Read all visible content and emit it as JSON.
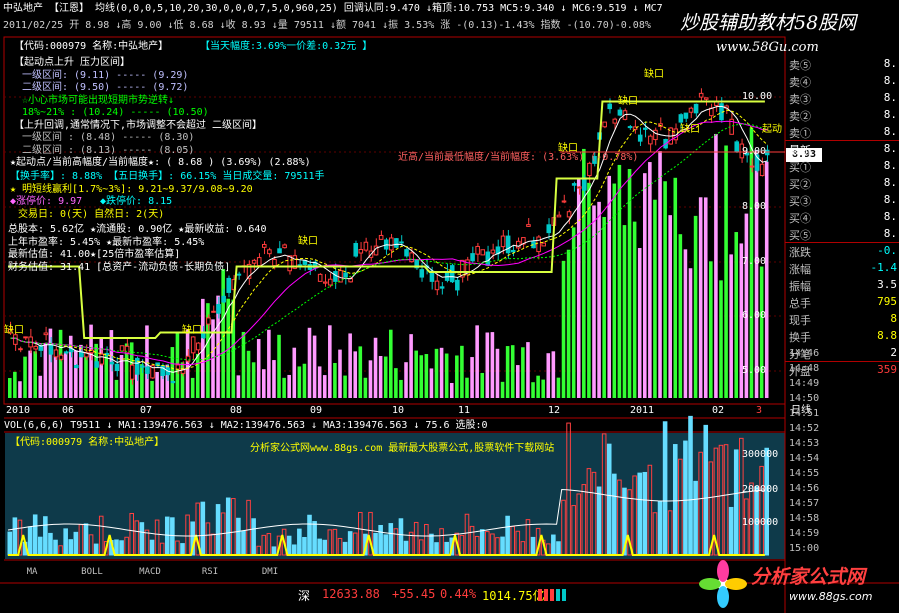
{
  "header": {
    "line1": "中弘地产  【江恩】 均线(0,0,0,5,10,20,30,0,0,0,7,5,0,960,25)  回调认同:9.470 ↓箱顶:10.753  MC5:9.340 ↓ MC6:9.519 ↓ MC7",
    "line2": "2011/02/25  开 8.98 ↓高 9.00 ↓低 8.68 ↓收 8.93 ↓量 79511 ↓额 7041 ↓振 3.53% 涨 -(0.13)-1.43% 指数 -(10.70)-0.08%",
    "watermark": "炒股辅助教材58股网",
    "watermark_url": "www.58Gu.com"
  },
  "info": {
    "code_name": "【代码:000979 名称:中弘地产】",
    "today_range": "【当天幅度:3.69%一价差:0.32元 】",
    "start_up": "【起动点上升  压力区间】",
    "zone1": "一级区间: (9.11) ----- (9.29)",
    "zone2": "二级区间: (9.50) ----- (9.72)",
    "warn": "☆小心市场可能出现短期市势逆转↓",
    "range_pct": "18%~21%  : (10.24) ----- (10.50)",
    "pullback": "【上升回调,通常情况下,市场调整不会超过 二级区间】",
    "pb_zone1": "一级区间  : (8.48) ----- (8.30)",
    "pb_zone2": "二级区间  : (8.13) ----- (8.05)",
    "start_line": "★起动点/当前高幅度/当前幅度★: ( 8.68  )  (3.69%)  (2.88%)",
    "turnover": "【换手率】: 8.88%  【五日换手】: 66.15% 当日成交量: 79511手",
    "profit": "明短线赢利[1.7%~3%]: 9.21~9.37/9.08~9.20",
    "limit_up": "涨停价: 9.97",
    "limit_down": "跌停价: 8.15",
    "trade_days": "交易日: 0(天)  自然日: 2(天)",
    "capital": "总股本: 5.62亿  ★流通股: 0.90亿  ★最新收益: 0.640",
    "pe1": "上年市盈率: 5.45%  ★最新市盈率: 5.45%",
    "nav": "最新估值: 41.00★[25倍市盈率估算]",
    "fin": "财务估值: 31.41 [总资产-流动负债-长期负债]",
    "near_high": "近高/当前最低幅度/当前幅度: (3.63%) (-0.78%)"
  },
  "labels": {
    "gap": "缺口",
    "start_point": "起动",
    "current_price": "8.93"
  },
  "price_axis": [
    "10.00",
    "9.00",
    "8.00",
    "7.00",
    "6.00",
    "5.00"
  ],
  "date_axis": [
    "2010",
    "06",
    "07",
    "08",
    "09",
    "10",
    "11",
    "12",
    "2011",
    "02",
    "3"
  ],
  "date_mode": "日线",
  "volume": {
    "header": "VOL(6,6,6)  T9511 ↓ MA1:139476.563 ↓ MA2:139476.563 ↓ MA3:139476.563 ↓ 75.6  选股:0",
    "code_name": "【代码:000979 名称:中弘地产】",
    "ad": "分析家公式网www.88gs.com 最新最大股票公式,股票软件下载网站",
    "axis": [
      "300000",
      "200000",
      "100000"
    ]
  },
  "side_panel": {
    "rows": [
      {
        "label": "卖⑤",
        "value": "8."
      },
      {
        "label": "卖④",
        "value": "8."
      },
      {
        "label": "卖③",
        "value": "8."
      },
      {
        "label": "卖②",
        "value": "8."
      },
      {
        "label": "卖①",
        "value": "8."
      },
      {
        "label": "最新",
        "value": "8."
      },
      {
        "label": "买①",
        "value": "8."
      },
      {
        "label": "买②",
        "value": "8."
      },
      {
        "label": "买③",
        "value": "8."
      },
      {
        "label": "买④",
        "value": "8."
      },
      {
        "label": "买⑤",
        "value": "8."
      },
      {
        "label": "涨跌",
        "value": "-0."
      },
      {
        "label": "涨幅",
        "value": "-1.4"
      },
      {
        "label": "振幅",
        "value": "3.5"
      },
      {
        "label": "总手",
        "value": "795"
      },
      {
        "label": "现手",
        "value": "8"
      },
      {
        "label": "换手",
        "value": "8.8"
      },
      {
        "label": "分笔",
        "value": "2"
      },
      {
        "label": "外盘",
        "value": "359"
      }
    ],
    "times": [
      "14:46",
      "14:48",
      "14:49",
      "14:50",
      "14:51",
      "14:52",
      "14:53",
      "14:54",
      "14:55",
      "14:56",
      "14:57",
      "14:58",
      "14:59",
      "15:00"
    ]
  },
  "tabs": [
    "MA",
    "BOLL",
    "MACD",
    "RSI",
    "DMI"
  ],
  "status_bar": {
    "market": "深",
    "index": "12633.88",
    "change": "+55.45",
    "pct": "0.44%",
    "amount": "1014.75亿"
  },
  "logo": {
    "text": "分析家公式网",
    "url": "www.88gs.com"
  },
  "colors": {
    "up": "#ff3c3c",
    "down": "#00c8c8",
    "bar_pink": "#ff99ff",
    "bar_green": "#33ff33",
    "yellow": "#ffff00",
    "magenta": "#ff00ff"
  }
}
